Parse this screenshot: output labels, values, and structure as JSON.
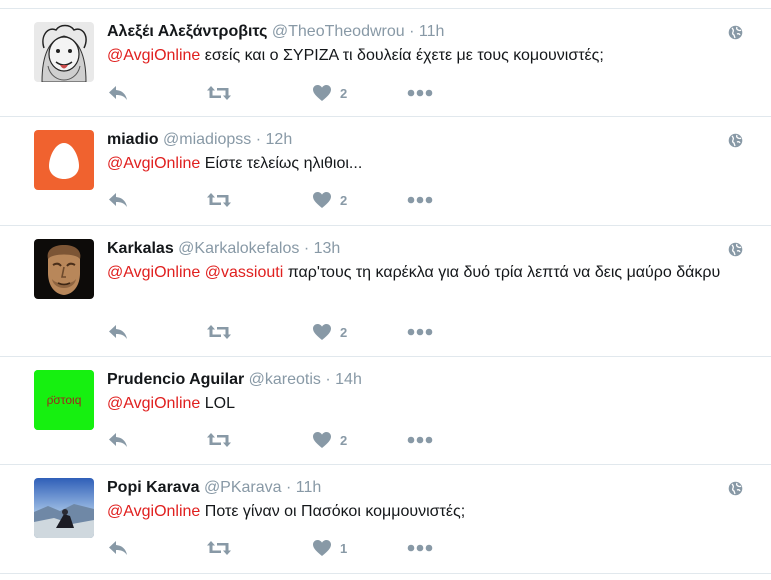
{
  "tweets": [
    {
      "fullname": "Αλεξέι Αλεξάντροβιτς",
      "username": "@TheoTheodwrou",
      "time": "11h",
      "mentions": [
        "@AvgiOnline"
      ],
      "text": " εσείς και ο ΣΥΡΙΖΑ τι δουλεία έχετε με τους κομουνιστές;",
      "likes": "2",
      "avatar": "sketch-face"
    },
    {
      "fullname": "miadio",
      "username": "@miadiopss",
      "time": "12h",
      "mentions": [
        "@AvgiOnline"
      ],
      "text": " Είστε τελείως ηλιθιοι...",
      "likes": "2",
      "avatar": "egg"
    },
    {
      "fullname": "Karkalas",
      "username": "@Karkalokefalos",
      "time": "13h",
      "mentions": [
        "@AvgiOnline",
        "@vassiouti"
      ],
      "text": " παρ'τους τη καρέκλα για δυό τρία λεπτά να δεις μαύρο δάκρυ",
      "likes": "2",
      "avatar": "ancient-mask"
    },
    {
      "fullname": "Prudencio Aguilar",
      "username": "@kareotis",
      "time": "14h",
      "mentions": [
        "@AvgiOnline"
      ],
      "text": " LOL",
      "likes": "2",
      "avatar": "green-text",
      "avatar_text": "ρ̈στοιq"
    },
    {
      "fullname": "Popi Karava",
      "username": "@PKarava",
      "time": "11h",
      "mentions": [
        "@AvgiOnline"
      ],
      "text": " Ποτε γίναν οι Πασόκοι κομμουνιστές;",
      "likes": "1",
      "avatar": "landscape-photo"
    }
  ],
  "colors": {
    "mention": "#e0201f",
    "meta": "#8899a6",
    "divider": "#e1e8ed",
    "egg_bg": "#f0622f",
    "green_bg": "#16f010"
  }
}
